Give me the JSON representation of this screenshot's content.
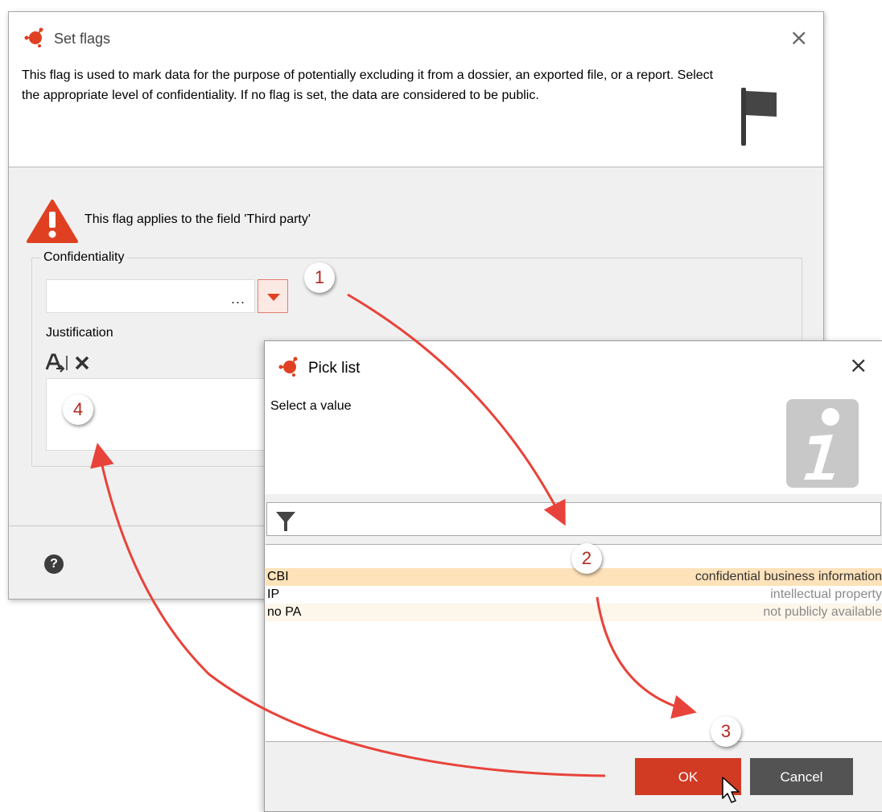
{
  "flags_dialog": {
    "title": "Set flags",
    "description": "This flag is used to mark data for the purpose of potentially excluding it from a dossier, an exported file, or a report. Select the appropriate level of confidentiality. If no flag is set, the data are considered to be public.",
    "warning": "This flag applies to the field 'Third party'",
    "confidentiality_label": "Confidentiality",
    "confidentiality_value": "",
    "dots": "...",
    "justification_label": "Justification",
    "justification_value": "",
    "help_glyph": "?",
    "close_glyph": "×"
  },
  "pick_list": {
    "title": "Pick list",
    "subtitle": "Select a value",
    "filter_value": "",
    "close_glyph": "×",
    "items": [
      {
        "code": "CBI",
        "description": "confidential business information"
      },
      {
        "code": "IP",
        "description": "intellectual property"
      },
      {
        "code": "no PA",
        "description": "not publicly available"
      }
    ],
    "ok_label": "OK",
    "cancel_label": "Cancel"
  },
  "callouts": [
    "1",
    "2",
    "3",
    "4"
  ],
  "colors": {
    "accent": "#d13a23",
    "selected_row": "#fde2ba",
    "warning": "#e04022"
  },
  "icons": [
    "app-logo-icon",
    "flag-icon",
    "warning-icon",
    "dropdown-arrow-icon",
    "text-format-icon",
    "clear-icon",
    "help-icon",
    "info-icon",
    "filter-icon",
    "close-icon",
    "cursor-icon"
  ]
}
